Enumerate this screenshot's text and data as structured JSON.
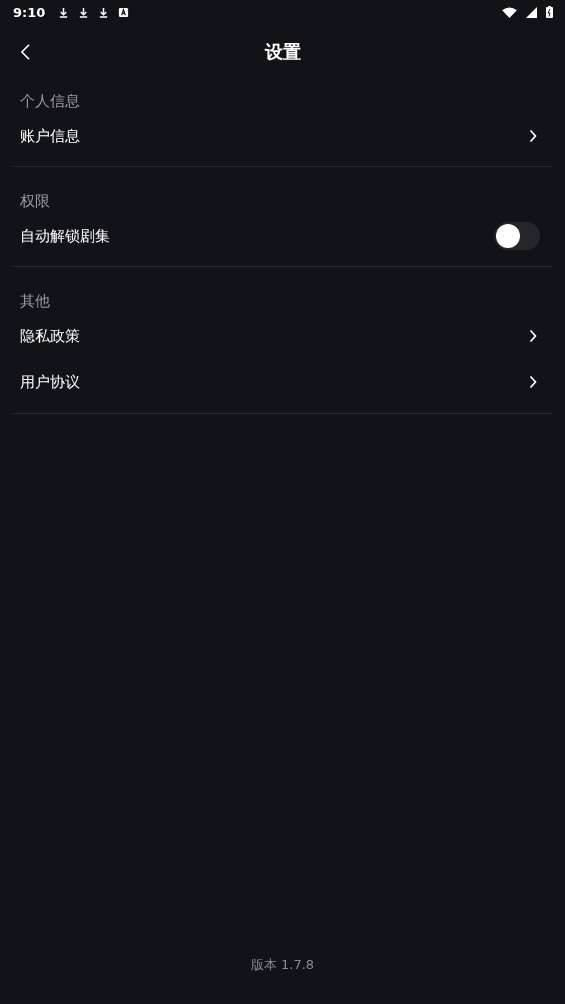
{
  "status_bar": {
    "time": "9:10"
  },
  "header": {
    "title": "设置"
  },
  "sections": [
    {
      "title": "个人信息",
      "items": [
        {
          "kind": "link",
          "label": "账户信息"
        }
      ]
    },
    {
      "title": "权限",
      "items": [
        {
          "kind": "toggle",
          "label": "自动解锁剧集",
          "on": false
        }
      ]
    },
    {
      "title": "其他",
      "items": [
        {
          "kind": "link",
          "label": "隐私政策"
        },
        {
          "kind": "link",
          "label": "用户协议"
        }
      ]
    }
  ],
  "footer": {
    "version": "版本 1.7.8"
  }
}
